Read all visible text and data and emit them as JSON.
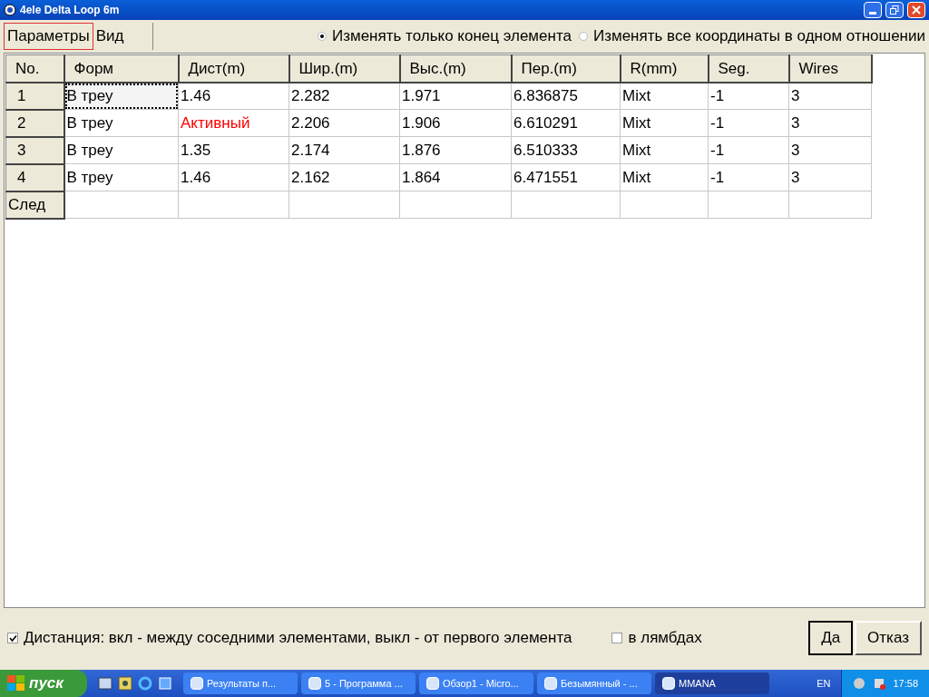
{
  "window": {
    "title": "4ele Delta Loop 6m"
  },
  "tabs": [
    {
      "label": "Параметры",
      "selected": true
    },
    {
      "label": "Вид",
      "selected": false
    }
  ],
  "mode_options": [
    {
      "label": "Изменять только конец элемента",
      "selected": true
    },
    {
      "label": "Изменять все координаты в одном отношении",
      "selected": false
    }
  ],
  "table": {
    "columns": [
      "No.",
      "Форм",
      "Дист(m)",
      "Шир.(m)",
      "Выс.(m)",
      "Пер.(m)",
      "R(mm)",
      "Seg.",
      "Wires"
    ],
    "rows": [
      {
        "focused": true,
        "cells": [
          "1",
          "В треу",
          "1.46",
          "2.282",
          "1.971",
          "6.836875",
          "Mixt",
          "-1",
          "3"
        ]
      },
      {
        "focused": false,
        "cells": [
          "2",
          "В треу",
          {
            "text": "Активный",
            "color": "#ff0000"
          },
          "2.206",
          "1.906",
          "6.610291",
          "Mixt",
          "-1",
          "3"
        ]
      },
      {
        "focused": false,
        "cells": [
          "3",
          "В треу",
          "1.35",
          "2.174",
          "1.876",
          "6.510333",
          "Mixt",
          "-1",
          "3"
        ]
      },
      {
        "focused": false,
        "cells": [
          "4",
          "В треу",
          "1.46",
          "2.162",
          "1.864",
          "6.471551",
          "Mixt",
          "-1",
          "3"
        ]
      },
      {
        "focused": false,
        "cells": [
          "След",
          "",
          "",
          "",
          "",
          "",
          "",
          "",
          ""
        ]
      }
    ]
  },
  "options": [
    {
      "label": "Дистанция: вкл - между соседними элементами, выкл - от первого элемента",
      "checked": true
    },
    {
      "label": "в лямбдах",
      "checked": false
    }
  ],
  "buttons": [
    "Да",
    "Отказ"
  ],
  "taskbar": {
    "start": "пуск",
    "tasks": [
      {
        "label": "Результаты п...",
        "selected": false
      },
      {
        "label": "5 - Программа ...",
        "selected": false
      },
      {
        "label": "Обзор1 - Micro...",
        "selected": false
      },
      {
        "label": "Безымянный - ...",
        "selected": false
      },
      {
        "label": "MMANA",
        "selected": true
      }
    ],
    "language": "EN",
    "clock": "17:58"
  }
}
